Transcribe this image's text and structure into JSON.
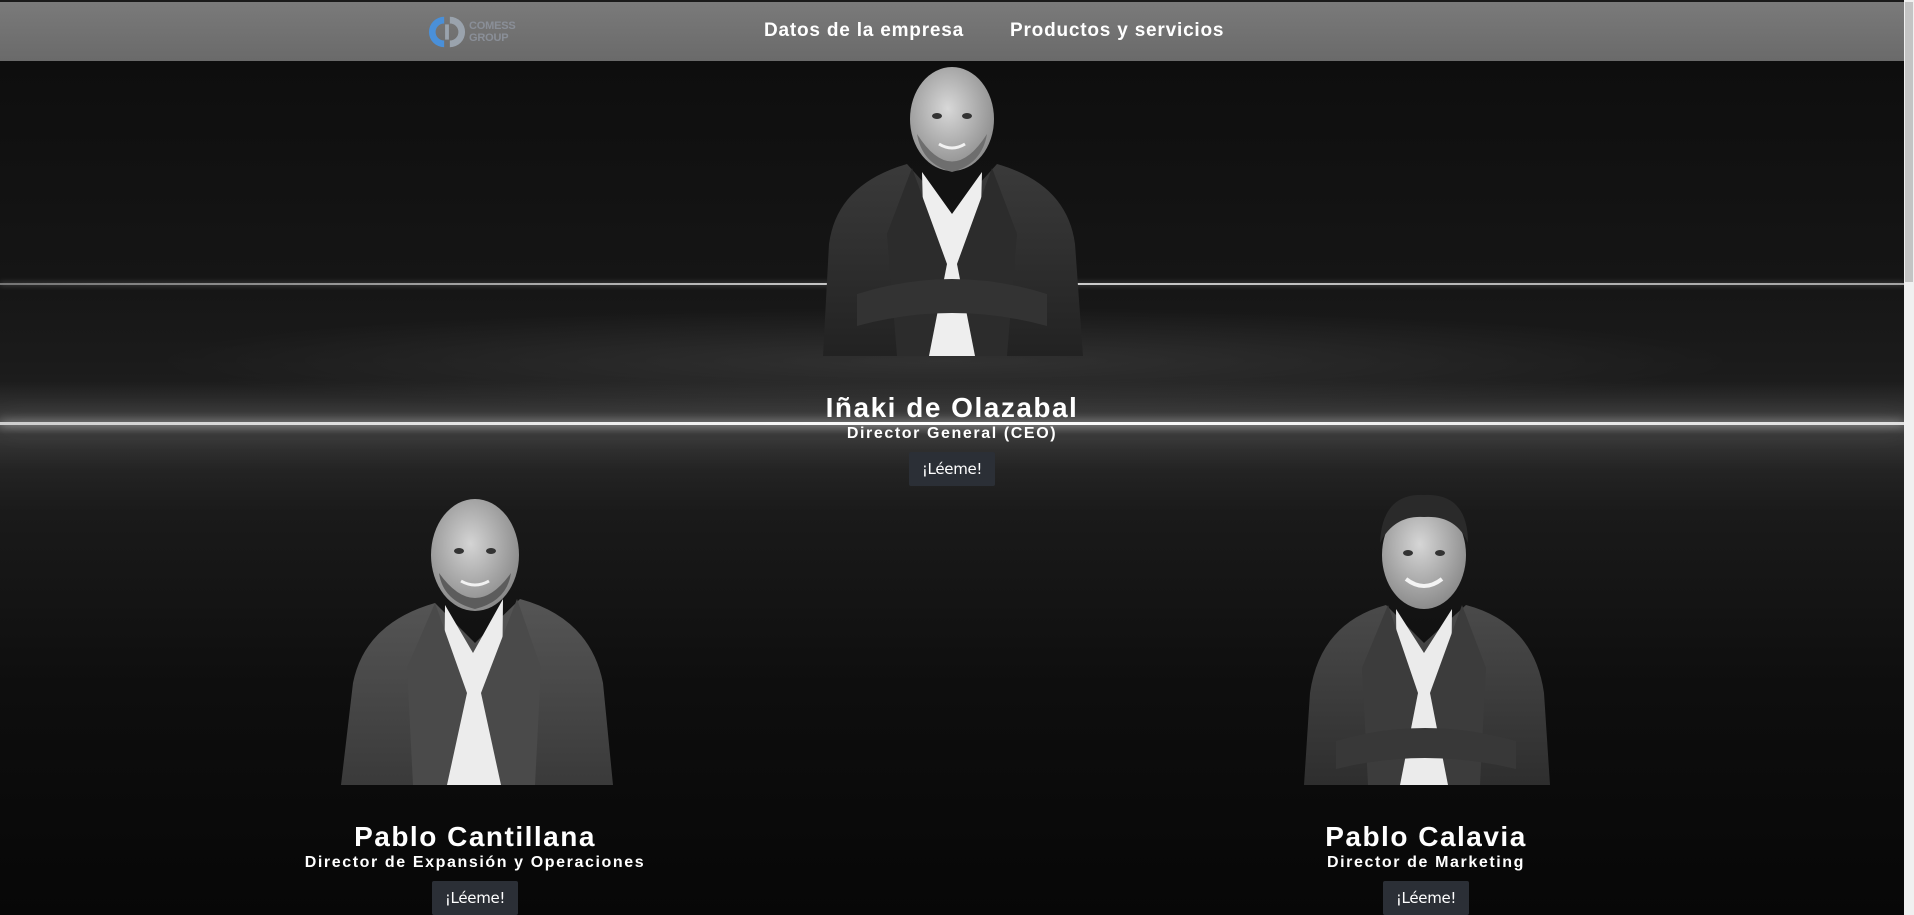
{
  "header": {
    "logo": {
      "line1": "COMESS",
      "line2": "GROUP"
    },
    "nav": [
      {
        "label": "Datos de la empresa"
      },
      {
        "label": "Productos y servicios"
      }
    ]
  },
  "people": [
    {
      "name": "Iñaki de Olazabal",
      "role": "Director General (CEO)",
      "button": "¡Léeme!"
    },
    {
      "name": "Pablo Cantillana",
      "role": "Director de Expansión y Operaciones",
      "button": "¡Léeme!"
    },
    {
      "name": "Pablo Calavia",
      "role": "Director de Marketing",
      "button": "¡Léeme!"
    }
  ],
  "colors": {
    "header_bg": "#707070",
    "button_bg": "#2b2f36",
    "text": "#ffffff",
    "logo_blue": "#4a90d9"
  },
  "icons": {
    "logo": "comess-group-logo"
  }
}
